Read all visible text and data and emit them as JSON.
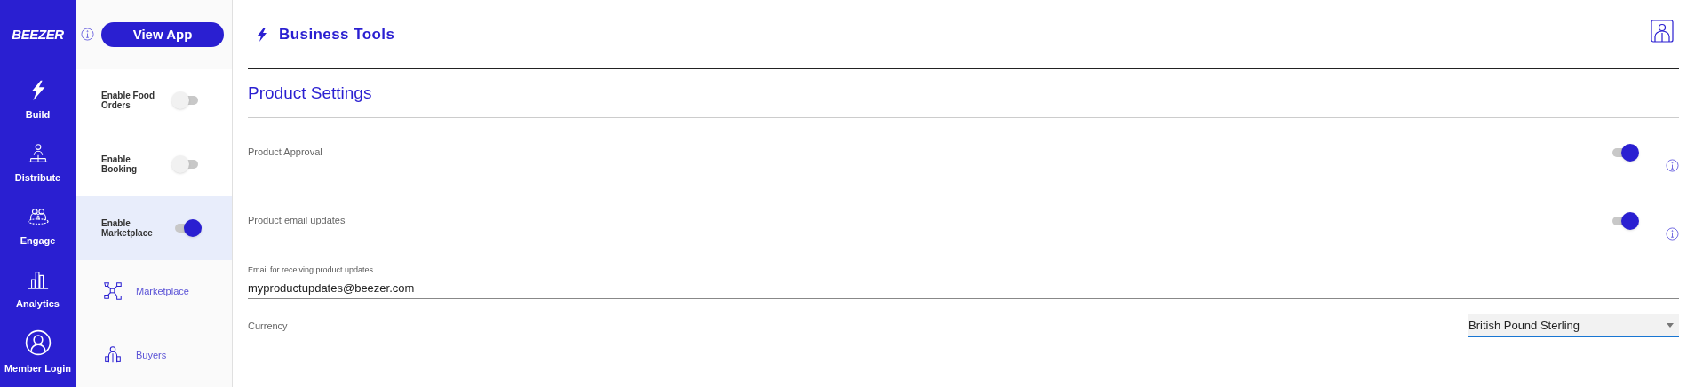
{
  "nav": {
    "logo": "BEEZER",
    "items": [
      {
        "label": "Build"
      },
      {
        "label": "Distribute"
      },
      {
        "label": "Engage"
      },
      {
        "label": "Analytics"
      },
      {
        "label": "Member Login"
      }
    ]
  },
  "panel": {
    "view_app": "View App",
    "items": [
      {
        "kind": "toggle",
        "label": "Enable Food Orders",
        "on": false,
        "selected": false
      },
      {
        "kind": "toggle",
        "label": "Enable Booking",
        "on": false,
        "selected": false
      },
      {
        "kind": "toggle",
        "label": "Enable Marketplace",
        "on": true,
        "selected": true
      },
      {
        "kind": "link",
        "label": "Marketplace"
      },
      {
        "kind": "link",
        "label": "Buyers"
      }
    ]
  },
  "header": {
    "title": "Business Tools"
  },
  "section": {
    "title": "Product Settings",
    "settings": [
      {
        "kind": "toggle",
        "label": "Product Approval",
        "on": true
      },
      {
        "kind": "toggle",
        "label": "Product email updates",
        "on": true
      },
      {
        "kind": "text",
        "label": "Email for receiving product updates",
        "value": "myproductupdates@beezer.com"
      },
      {
        "kind": "select",
        "label": "Currency",
        "value": "British Pound Sterling"
      }
    ]
  }
}
